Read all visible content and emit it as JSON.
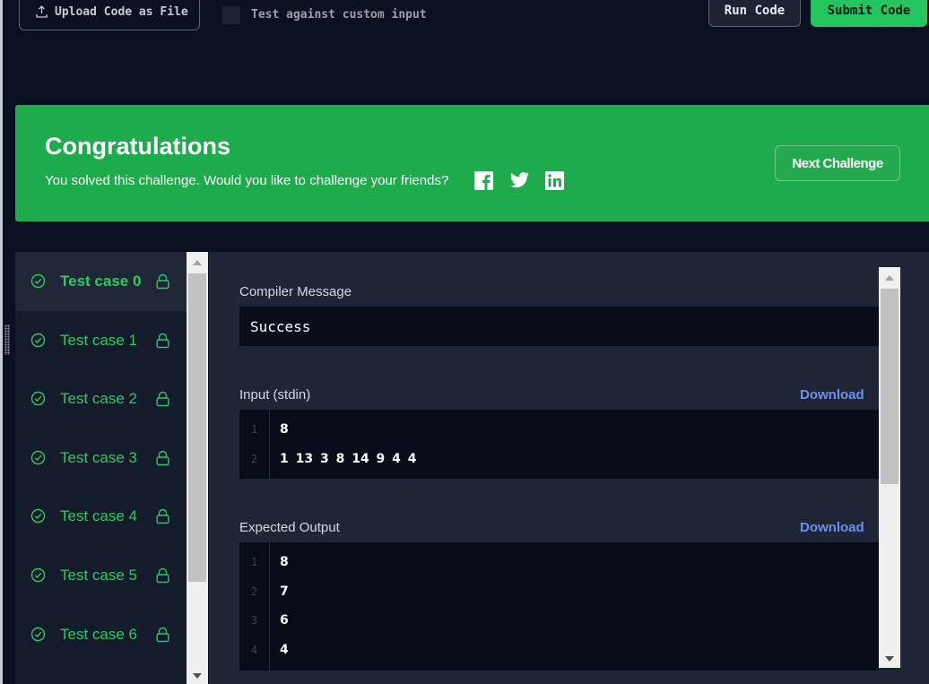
{
  "toolbar": {
    "upload_label": "Upload Code as File",
    "custom_input_label": "Test against custom input",
    "run_label": "Run Code",
    "submit_label": "Submit Code"
  },
  "banner": {
    "title": "Congratulations",
    "message": "You solved this challenge. Would you like to challenge your friends?",
    "next_label": "Next Challenge",
    "social_icons": [
      "facebook-icon",
      "twitter-icon",
      "linkedin-icon"
    ],
    "color": "#1dab4c"
  },
  "test_cases": [
    {
      "label": "Test case 0",
      "active": true
    },
    {
      "label": "Test case 1",
      "active": false
    },
    {
      "label": "Test case 2",
      "active": false
    },
    {
      "label": "Test case 3",
      "active": false
    },
    {
      "label": "Test case 4",
      "active": false
    },
    {
      "label": "Test case 5",
      "active": false
    },
    {
      "label": "Test case 6",
      "active": false
    }
  ],
  "result": {
    "compiler_label": "Compiler Message",
    "compiler_message": "Success",
    "input_label": "Input (stdin)",
    "input_download": "Download",
    "input_lines": [
      {
        "num": "1",
        "text": "8"
      },
      {
        "num": "2",
        "text": "1 13 3 8 14 9 4 4"
      }
    ],
    "expected_label": "Expected Output",
    "expected_download": "Download",
    "expected_lines": [
      {
        "num": "1",
        "text": "8"
      },
      {
        "num": "2",
        "text": "7"
      },
      {
        "num": "3",
        "text": "6"
      },
      {
        "num": "4",
        "text": "4"
      }
    ]
  },
  "colors": {
    "accent_green": "#2ec866",
    "submit_green": "#22c55e",
    "link_blue": "#6e8ff0",
    "background": "#0a1020"
  }
}
